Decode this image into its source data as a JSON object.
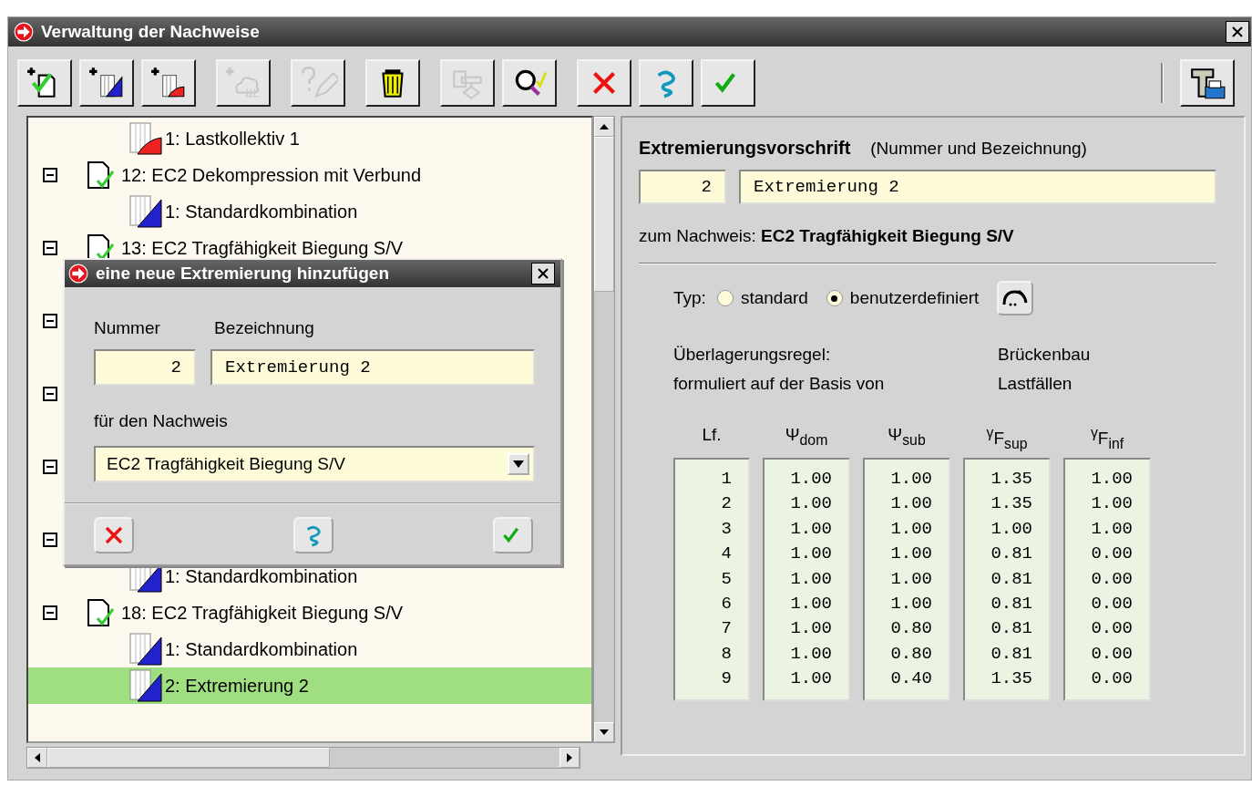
{
  "window": {
    "title": "Verwaltung der Nachweise"
  },
  "toolbar": [
    {
      "kind": "add-proof",
      "disabled": false
    },
    {
      "kind": "add-combination",
      "disabled": false
    },
    {
      "kind": "add-collective",
      "disabled": false
    },
    {
      "kind": "add-cloud",
      "disabled": true
    },
    {
      "kind": "help-edit",
      "disabled": true
    },
    {
      "kind": "trash",
      "disabled": false
    },
    {
      "kind": "flowchart",
      "disabled": true
    },
    {
      "kind": "check-search",
      "disabled": false
    },
    {
      "kind": "delete",
      "disabled": false
    },
    {
      "kind": "help",
      "disabled": false
    },
    {
      "kind": "ok",
      "disabled": false
    },
    {
      "kind": "print-text",
      "disabled": false
    }
  ],
  "tree": [
    {
      "children": [
        {
          "kind": "collective",
          "label": "1: Lastkollektiv 1",
          "selected": false
        }
      ]
    },
    {
      "kind": "proof",
      "label": "12: EC2 Dekompression mit Verbund",
      "expanded": true,
      "children": [
        {
          "kind": "combination",
          "label": "1: Standardkombination",
          "selected": false
        }
      ]
    },
    {
      "kind": "proof",
      "label": "13: EC2 Tragfähigkeit Biegung S/V",
      "expanded": true,
      "children": [
        {
          "kind": "blank",
          "selected": false
        }
      ]
    },
    {
      "kind": "proof",
      "expanded": true,
      "children": [
        {
          "kind": "blank",
          "selected": false
        }
      ]
    },
    {
      "kind": "proof",
      "expanded": true,
      "children": [
        {
          "kind": "blank",
          "selected": false
        }
      ]
    },
    {
      "kind": "proof",
      "expanded": true,
      "children": [
        {
          "kind": "blank",
          "selected": false
        }
      ]
    },
    {
      "kind": "proof",
      "expanded": true,
      "children": [
        {
          "kind": "combination",
          "label": "1: Standardkombination",
          "selected": false
        }
      ]
    },
    {
      "kind": "proof",
      "label": "18: EC2 Tragfähigkeit Biegung S/V",
      "expanded": true,
      "children": [
        {
          "kind": "combination",
          "label": "1: Standardkombination",
          "selected": false
        },
        {
          "kind": "combination",
          "label": "2: Extremierung 2",
          "selected": true
        }
      ]
    }
  ],
  "detail": {
    "heading": "Extremierungsvorschrift",
    "heading_hint": "(Nummer und Bezeichnung)",
    "number": "2",
    "name": "Extremierung 2",
    "proof_text": "zum Nachweis: **EC2 Tragfähigkeit Biegung S/V**",
    "type_label": "Typ:",
    "type_options": [
      {
        "label": "standard",
        "selected": false
      },
      {
        "label": "benutzerdefiniert",
        "selected": true
      }
    ],
    "info": [
      {
        "label": "Überlagerungsregel:",
        "value": "Brückenbau"
      },
      {
        "label": "formuliert auf der Basis von",
        "value": "Lastfällen"
      }
    ],
    "columns": [
      {
        "header": "Lf.",
        "values": [
          "1",
          "2",
          "3",
          "4",
          "5",
          "6",
          "7",
          "8",
          "9"
        ]
      },
      {
        "header": "Ψ$_{dom}$",
        "values": [
          "1.00",
          "1.00",
          "1.00",
          "1.00",
          "1.00",
          "1.00",
          "1.00",
          "1.00",
          "1.00"
        ]
      },
      {
        "header": "Ψ$_{sub}$",
        "values": [
          "1.00",
          "1.00",
          "1.00",
          "1.00",
          "1.00",
          "1.00",
          "0.80",
          "0.80",
          "0.40"
        ]
      },
      {
        "header": "$^{γ}$F$_{sup}$",
        "values": [
          "1.35",
          "1.35",
          "1.00",
          "0.81",
          "0.81",
          "0.81",
          "0.81",
          "0.81",
          "1.35"
        ]
      },
      {
        "header": "$^{γ}$F$_{inf}$",
        "values": [
          "1.00",
          "1.00",
          "1.00",
          "0.00",
          "0.00",
          "0.00",
          "0.00",
          "0.00",
          "0.00"
        ]
      }
    ]
  },
  "dialog": {
    "title": "eine neue Extremierung hinzufügen",
    "number_label": "Nummer",
    "name_label": "Bezeichnung",
    "number": "2",
    "name": "Extremierung 2",
    "proof_label": "für den Nachweis",
    "proof": "EC2 Tragfähigkeit Biegung S/V",
    "buttons": [
      {
        "kind": "cancel"
      },
      {
        "kind": "help"
      },
      {
        "kind": "ok"
      }
    ]
  }
}
